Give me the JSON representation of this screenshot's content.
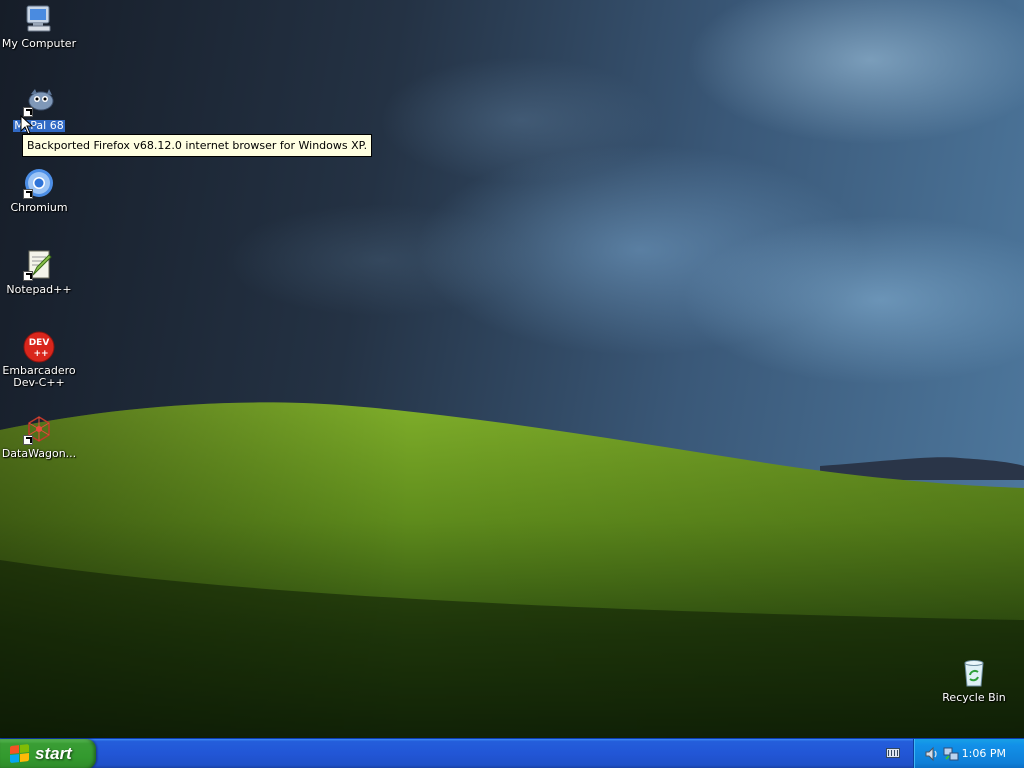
{
  "desktop": {
    "icons": [
      {
        "label": "My Computer",
        "icon": "my-computer-icon"
      },
      {
        "label": "MyPal 68",
        "icon": "mypal-browser-icon",
        "selected": true
      },
      {
        "label": "Chromium",
        "icon": "chromium-icon"
      },
      {
        "label": "Notepad++",
        "icon": "notepad-plus-plus-icon"
      },
      {
        "label": "Embarcadero\nDev-C++",
        "icon": "dev-cpp-icon"
      },
      {
        "label": "DataWagon...",
        "icon": "datawagon-icon"
      },
      {
        "label": "Recycle Bin",
        "icon": "recycle-bin-icon"
      }
    ]
  },
  "tooltip": {
    "text": "Backported Firefox v68.12.0 internet browser for Windows XP."
  },
  "taskbar": {
    "start_label": "start",
    "tray": {
      "icons": [
        "keyboard-layout-icon",
        "speaker-icon",
        "network-icon"
      ],
      "clock": "1:06 PM"
    }
  },
  "colors": {
    "taskbar_blue": "#245edb",
    "start_green": "#339a2e",
    "tray_blue": "#0f7fd8",
    "tooltip_bg": "#ffffe1",
    "selection": "#316ac5"
  }
}
